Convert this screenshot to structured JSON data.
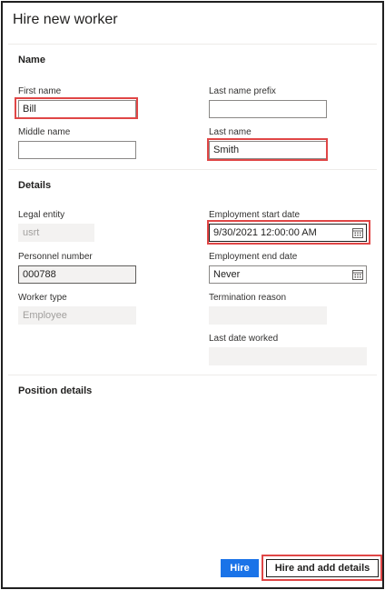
{
  "dialog": {
    "title": "Hire new worker"
  },
  "sections": {
    "name": "Name",
    "details": "Details",
    "position_details": "Position details"
  },
  "fields": {
    "first_name": {
      "label": "First name",
      "value": "Bill"
    },
    "last_name_prefix": {
      "label": "Last name prefix",
      "value": ""
    },
    "middle_name": {
      "label": "Middle name",
      "value": ""
    },
    "last_name": {
      "label": "Last name",
      "value": "Smith"
    },
    "legal_entity": {
      "label": "Legal entity",
      "value": "usrt"
    },
    "employment_start_date": {
      "label": "Employment start date",
      "value": "9/30/2021 12:00:00 AM"
    },
    "personnel_number": {
      "label": "Personnel number",
      "value": "000788"
    },
    "employment_end_date": {
      "label": "Employment end date",
      "value": "Never"
    },
    "worker_type": {
      "label": "Worker type",
      "value": "Employee"
    },
    "termination_reason": {
      "label": "Termination reason",
      "value": ""
    },
    "last_date_worked": {
      "label": "Last date worked",
      "value": ""
    }
  },
  "buttons": {
    "hire": "Hire",
    "hire_and_add_details": "Hire and add details"
  },
  "icons": {
    "date_picker": "calendar-icon"
  },
  "colors": {
    "primary": "#1a73e8",
    "highlight": "#e04646"
  }
}
